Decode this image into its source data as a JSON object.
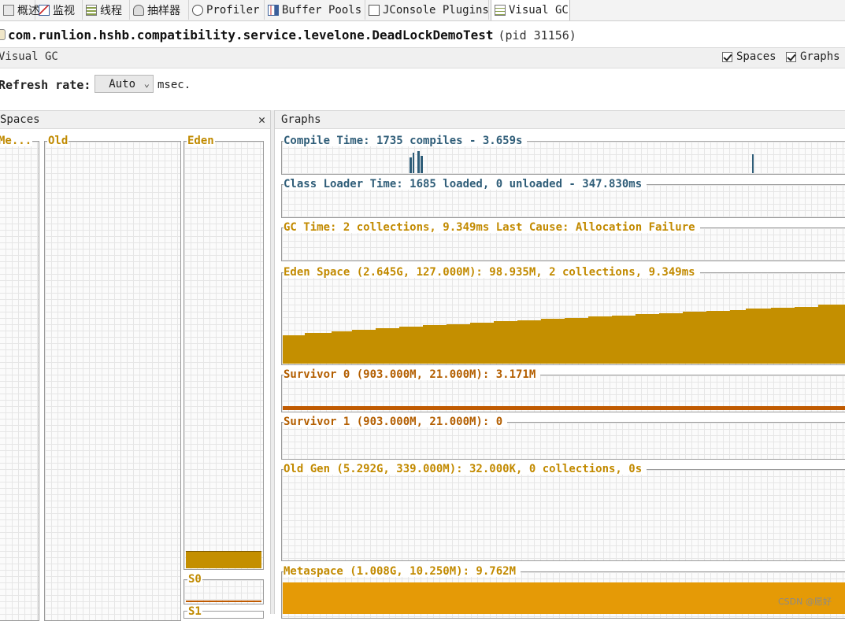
{
  "tabs": [
    {
      "label": "概述",
      "icon": "overview-icon"
    },
    {
      "label": "监视",
      "icon": "monitor-icon"
    },
    {
      "label": "线程",
      "icon": "threads-icon"
    },
    {
      "label": "抽样器",
      "icon": "sampler-icon"
    },
    {
      "label": "Profiler",
      "icon": "profiler-icon"
    },
    {
      "label": "Buffer Pools",
      "icon": "buffer-pools-icon"
    },
    {
      "label": "JConsole Plugins",
      "icon": "jconsole-icon"
    },
    {
      "label": "Visual GC",
      "icon": "visual-gc-icon",
      "active": true
    }
  ],
  "app": {
    "title": "com.runlion.hshb.compatibility.service.levelone.DeadLockDemoTest",
    "pid": "(pid 31156)"
  },
  "section": {
    "label": "Visual GC",
    "spaces_check": "Spaces",
    "graphs_check": "Graphs"
  },
  "refresh": {
    "label": "Refresh rate:",
    "value": "Auto",
    "unit": "msec."
  },
  "spaces_panel": {
    "title": "Spaces",
    "labels": {
      "meta": "Me...",
      "old": "Old",
      "eden": "Eden",
      "s0": "S0",
      "s1": "S1"
    },
    "eden_fill": 0.04,
    "s0_fill": 0.1
  },
  "graphs_panel": {
    "title": "Graphs",
    "graphs": [
      "Compile Time: 1735 compiles - 3.659s",
      "Class Loader Time: 1685 loaded, 0 unloaded - 347.830ms",
      "GC Time: 2 collections, 9.349ms Last Cause: Allocation Failure",
      "Eden Space (2.645G, 127.000M): 98.935M, 2 collections, 9.349ms",
      "Survivor 0 (903.000M, 21.000M): 3.171M",
      "Survivor 1 (903.000M, 21.000M): 0",
      "Old Gen (5.292G, 339.000M): 32.000K, 0 collections, 0s",
      "Metaspace (1.008G, 10.250M): 9.762M"
    ]
  },
  "colors": {
    "eden": "#c48f00",
    "survivor": "#c05a00",
    "metaspace": "#e59a06",
    "compile": "#2f5d78"
  },
  "watermark": "CSDN @愿好"
}
